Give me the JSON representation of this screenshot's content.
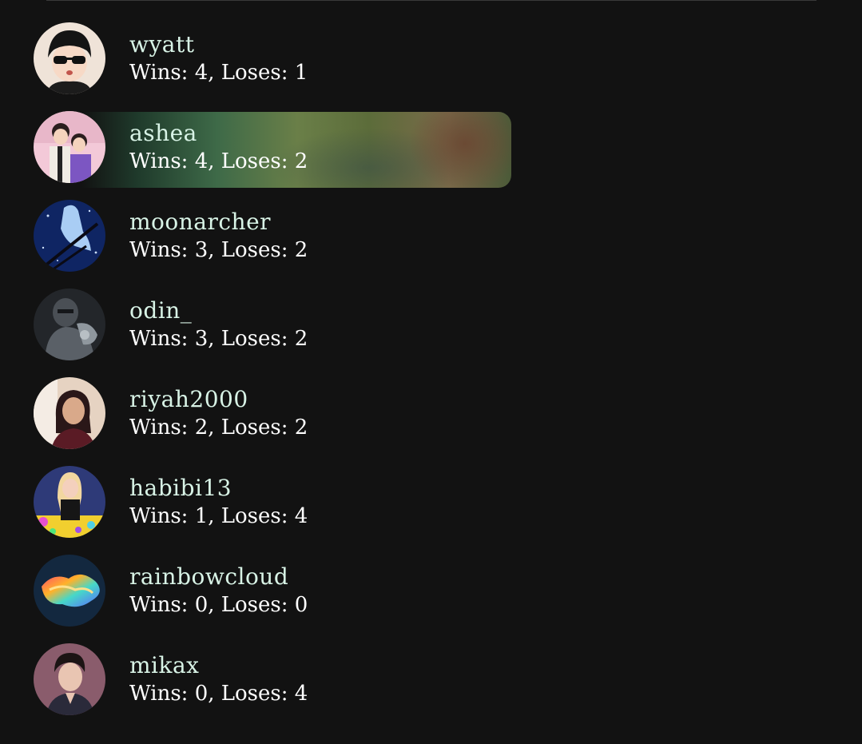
{
  "players": [
    {
      "name": "wyatt",
      "stats": "Wins: 4, Loses: 1",
      "avatar_icon": "avatar-sunglasses-boy-icon",
      "colors": [
        "#f1e6dc",
        "#1a1a1a"
      ]
    },
    {
      "name": "ashea",
      "stats": "Wins: 4, Loses: 2",
      "avatar_icon": "avatar-couple-icon",
      "colors": [
        "#f3c6d6",
        "#7f5ac0"
      ]
    },
    {
      "name": "moonarcher",
      "stats": "Wins: 3, Loses: 2",
      "avatar_icon": "avatar-archer-icon",
      "colors": [
        "#0f2a6a",
        "#9ec8f5"
      ]
    },
    {
      "name": "odin_",
      "stats": "Wins: 3, Loses: 2",
      "avatar_icon": "avatar-armored-knight-icon",
      "colors": [
        "#2c2f33",
        "#8a9196"
      ]
    },
    {
      "name": "riyah2000",
      "stats": "Wins: 2, Loses: 2",
      "avatar_icon": "avatar-woman-selfie-icon",
      "colors": [
        "#e3ccb8",
        "#5a1a22"
      ]
    },
    {
      "name": "habibi13",
      "stats": "Wins: 1, Loses: 4",
      "avatar_icon": "avatar-party-woman-icon",
      "colors": [
        "#2f3a7a",
        "#f2d034"
      ]
    },
    {
      "name": "rainbowcloud",
      "stats": "Wins: 0, Loses: 0",
      "avatar_icon": "avatar-rainbow-cloud-icon",
      "colors": [
        "#102a44",
        "#ff8a2a"
      ]
    },
    {
      "name": "mikax",
      "stats": "Wins: 0, Loses: 4",
      "avatar_icon": "avatar-man-portrait-icon",
      "colors": [
        "#8a5a6a",
        "#e8c2b0"
      ]
    }
  ],
  "highlighted_player": "ashea"
}
